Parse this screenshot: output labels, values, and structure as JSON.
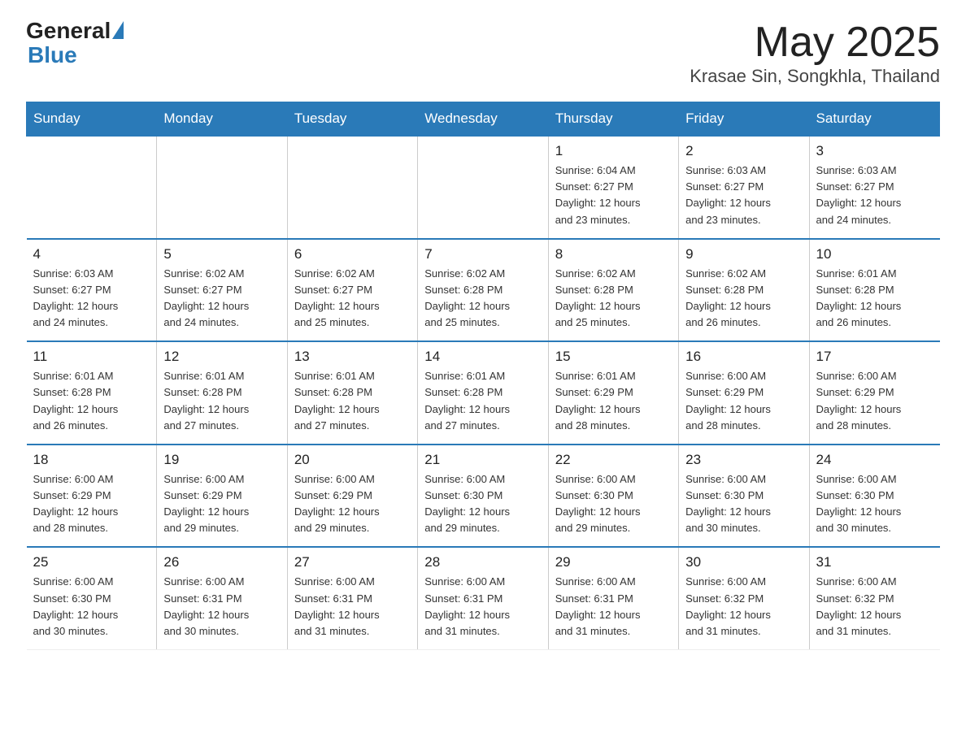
{
  "logo": {
    "general": "General",
    "blue": "Blue"
  },
  "title": "May 2025",
  "subtitle": "Krasae Sin, Songkhla, Thailand",
  "days_of_week": [
    "Sunday",
    "Monday",
    "Tuesday",
    "Wednesday",
    "Thursday",
    "Friday",
    "Saturday"
  ],
  "weeks": [
    [
      {
        "day": "",
        "info": ""
      },
      {
        "day": "",
        "info": ""
      },
      {
        "day": "",
        "info": ""
      },
      {
        "day": "",
        "info": ""
      },
      {
        "day": "1",
        "info": "Sunrise: 6:04 AM\nSunset: 6:27 PM\nDaylight: 12 hours\nand 23 minutes."
      },
      {
        "day": "2",
        "info": "Sunrise: 6:03 AM\nSunset: 6:27 PM\nDaylight: 12 hours\nand 23 minutes."
      },
      {
        "day": "3",
        "info": "Sunrise: 6:03 AM\nSunset: 6:27 PM\nDaylight: 12 hours\nand 24 minutes."
      }
    ],
    [
      {
        "day": "4",
        "info": "Sunrise: 6:03 AM\nSunset: 6:27 PM\nDaylight: 12 hours\nand 24 minutes."
      },
      {
        "day": "5",
        "info": "Sunrise: 6:02 AM\nSunset: 6:27 PM\nDaylight: 12 hours\nand 24 minutes."
      },
      {
        "day": "6",
        "info": "Sunrise: 6:02 AM\nSunset: 6:27 PM\nDaylight: 12 hours\nand 25 minutes."
      },
      {
        "day": "7",
        "info": "Sunrise: 6:02 AM\nSunset: 6:28 PM\nDaylight: 12 hours\nand 25 minutes."
      },
      {
        "day": "8",
        "info": "Sunrise: 6:02 AM\nSunset: 6:28 PM\nDaylight: 12 hours\nand 25 minutes."
      },
      {
        "day": "9",
        "info": "Sunrise: 6:02 AM\nSunset: 6:28 PM\nDaylight: 12 hours\nand 26 minutes."
      },
      {
        "day": "10",
        "info": "Sunrise: 6:01 AM\nSunset: 6:28 PM\nDaylight: 12 hours\nand 26 minutes."
      }
    ],
    [
      {
        "day": "11",
        "info": "Sunrise: 6:01 AM\nSunset: 6:28 PM\nDaylight: 12 hours\nand 26 minutes."
      },
      {
        "day": "12",
        "info": "Sunrise: 6:01 AM\nSunset: 6:28 PM\nDaylight: 12 hours\nand 27 minutes."
      },
      {
        "day": "13",
        "info": "Sunrise: 6:01 AM\nSunset: 6:28 PM\nDaylight: 12 hours\nand 27 minutes."
      },
      {
        "day": "14",
        "info": "Sunrise: 6:01 AM\nSunset: 6:28 PM\nDaylight: 12 hours\nand 27 minutes."
      },
      {
        "day": "15",
        "info": "Sunrise: 6:01 AM\nSunset: 6:29 PM\nDaylight: 12 hours\nand 28 minutes."
      },
      {
        "day": "16",
        "info": "Sunrise: 6:00 AM\nSunset: 6:29 PM\nDaylight: 12 hours\nand 28 minutes."
      },
      {
        "day": "17",
        "info": "Sunrise: 6:00 AM\nSunset: 6:29 PM\nDaylight: 12 hours\nand 28 minutes."
      }
    ],
    [
      {
        "day": "18",
        "info": "Sunrise: 6:00 AM\nSunset: 6:29 PM\nDaylight: 12 hours\nand 28 minutes."
      },
      {
        "day": "19",
        "info": "Sunrise: 6:00 AM\nSunset: 6:29 PM\nDaylight: 12 hours\nand 29 minutes."
      },
      {
        "day": "20",
        "info": "Sunrise: 6:00 AM\nSunset: 6:29 PM\nDaylight: 12 hours\nand 29 minutes."
      },
      {
        "day": "21",
        "info": "Sunrise: 6:00 AM\nSunset: 6:30 PM\nDaylight: 12 hours\nand 29 minutes."
      },
      {
        "day": "22",
        "info": "Sunrise: 6:00 AM\nSunset: 6:30 PM\nDaylight: 12 hours\nand 29 minutes."
      },
      {
        "day": "23",
        "info": "Sunrise: 6:00 AM\nSunset: 6:30 PM\nDaylight: 12 hours\nand 30 minutes."
      },
      {
        "day": "24",
        "info": "Sunrise: 6:00 AM\nSunset: 6:30 PM\nDaylight: 12 hours\nand 30 minutes."
      }
    ],
    [
      {
        "day": "25",
        "info": "Sunrise: 6:00 AM\nSunset: 6:30 PM\nDaylight: 12 hours\nand 30 minutes."
      },
      {
        "day": "26",
        "info": "Sunrise: 6:00 AM\nSunset: 6:31 PM\nDaylight: 12 hours\nand 30 minutes."
      },
      {
        "day": "27",
        "info": "Sunrise: 6:00 AM\nSunset: 6:31 PM\nDaylight: 12 hours\nand 31 minutes."
      },
      {
        "day": "28",
        "info": "Sunrise: 6:00 AM\nSunset: 6:31 PM\nDaylight: 12 hours\nand 31 minutes."
      },
      {
        "day": "29",
        "info": "Sunrise: 6:00 AM\nSunset: 6:31 PM\nDaylight: 12 hours\nand 31 minutes."
      },
      {
        "day": "30",
        "info": "Sunrise: 6:00 AM\nSunset: 6:32 PM\nDaylight: 12 hours\nand 31 minutes."
      },
      {
        "day": "31",
        "info": "Sunrise: 6:00 AM\nSunset: 6:32 PM\nDaylight: 12 hours\nand 31 minutes."
      }
    ]
  ]
}
